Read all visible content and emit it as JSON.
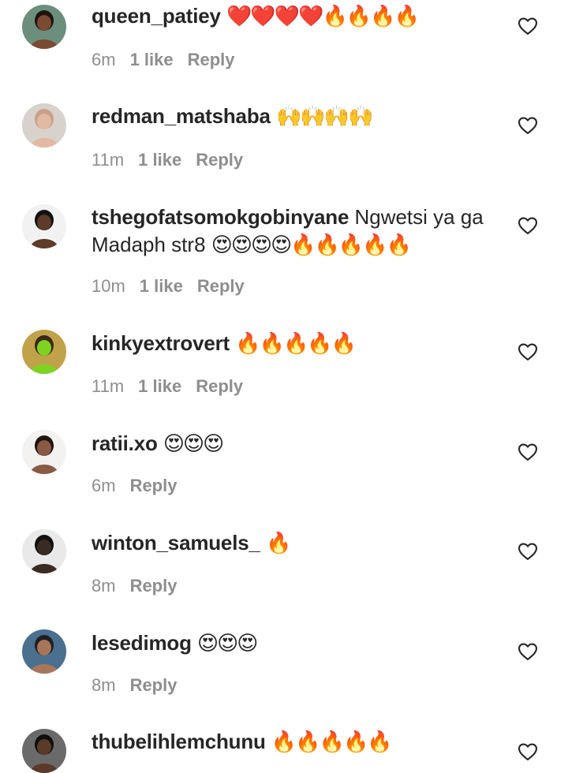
{
  "comments": [
    {
      "username": "queen_patiey",
      "text": "",
      "emojis": "❤️❤️❤️❤️🔥🔥🔥🔥",
      "time": "6m",
      "likes": "1 like",
      "reply": "Reply",
      "avatar": {
        "bg": "#6c8f7d",
        "skin": "#7a4a33",
        "hair": "#1c1410"
      }
    },
    {
      "username": "redman_matshaba",
      "text": "",
      "emojis": "🙌🙌🙌🙌",
      "time": "11m",
      "likes": "1 like",
      "reply": "Reply",
      "avatar": {
        "bg": "#d8d2cc",
        "skin": "#e2b9a2",
        "hair": "#caa08a"
      }
    },
    {
      "username": "tshegofatsomokgobinyane",
      "text": "Ngwetsi ya ga Madaph str8",
      "emojis": "😍😍😍😍🔥🔥🔥🔥🔥",
      "time": "10m",
      "likes": "1 like",
      "reply": "Reply",
      "avatar": {
        "bg": "#f2f2f2",
        "skin": "#5e3a28",
        "hair": "#121212"
      }
    },
    {
      "username": "kinkyextrovert",
      "text": "",
      "emojis": "🔥🔥🔥🔥🔥",
      "time": "11m",
      "likes": "1 like",
      "reply": "Reply",
      "avatar": {
        "bg": "#c0a24a",
        "skin": "#7ed321",
        "hair": "#3a2a1a"
      }
    },
    {
      "username": "ratii.xo",
      "text": "",
      "emojis": "😍😍😍",
      "time": "6m",
      "likes": "",
      "reply": "Reply",
      "avatar": {
        "bg": "#f4f1f1",
        "skin": "#8a5a45",
        "hair": "#1e1410"
      }
    },
    {
      "username": "winton_samuels_",
      "text": "",
      "emojis": "🔥",
      "time": "8m",
      "likes": "",
      "reply": "Reply",
      "avatar": {
        "bg": "#e9e9e9",
        "skin": "#3a2b22",
        "hair": "#101010"
      }
    },
    {
      "username": "lesedimog",
      "text": "",
      "emojis": "😍😍😍",
      "time": "8m",
      "likes": "",
      "reply": "Reply",
      "avatar": {
        "bg": "#4a6f8f",
        "skin": "#a8765a",
        "hair": "#1f1f1f"
      }
    },
    {
      "username": "thubelihlemchunu",
      "text": "",
      "emojis": "🔥🔥🔥🔥🔥",
      "time": "",
      "likes": "",
      "reply": "",
      "avatar": {
        "bg": "#6a6a6a",
        "skin": "#5a3b2a",
        "hair": "#0f0f0f"
      }
    }
  ],
  "icons": {
    "like": "heart-outline-icon"
  },
  "colors": {
    "text": "#262626",
    "meta": "#8e8e8e",
    "background": "#ffffff"
  }
}
